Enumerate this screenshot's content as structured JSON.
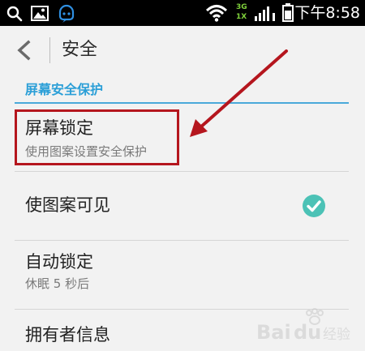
{
  "status_bar": {
    "net_top": "3G",
    "net_bottom": "1X",
    "time": "下午8:58",
    "icons": [
      "search-icon",
      "image-icon",
      "chat-bot-icon",
      "wifi-icon",
      "signal-icon",
      "battery-icon"
    ]
  },
  "action_bar": {
    "title": "安全",
    "back_icon": "chevron-left-icon"
  },
  "section": {
    "header": "屏幕安全保护"
  },
  "items": [
    {
      "title": "屏幕锁定",
      "summary": "使用图案设置安全保护"
    },
    {
      "title": "使图案可见",
      "checked": true
    },
    {
      "title": "自动锁定",
      "summary": "休眠 5 秒后"
    },
    {
      "title": "拥有者信息"
    }
  ],
  "colors": {
    "accent": "#2b9fd7",
    "check_teal": "#4cc2b6",
    "annotation_red": "#b5161e"
  },
  "watermark": {
    "text": "Baidu 经验"
  }
}
